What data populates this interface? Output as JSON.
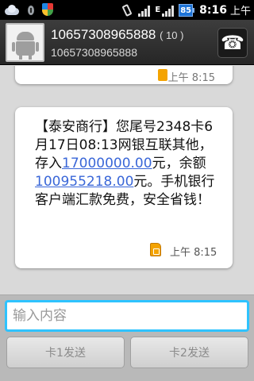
{
  "status_bar": {
    "time": "8:16",
    "ampm": "上午",
    "network": "E",
    "battery": "85",
    "icons": [
      "weather-icon",
      "mic-icon",
      "shield-icon",
      "vibrate-icon",
      "signal-icon",
      "signal-icon",
      "battery-icon"
    ]
  },
  "header": {
    "contact_number": "10657308965888",
    "count": "( 10 )",
    "subtitle": "10657308965888",
    "call_icon": "phone-icon"
  },
  "conversation": {
    "previous_message_time": "上午 8:15",
    "message": {
      "text_before_link1": "【泰安商行】您尾号2348卡6月17日08:13网银互联其他，存入",
      "link1": "17000000.00",
      "text_between": "元，余额",
      "link2": "100955218.00",
      "text_after": "元。手机银行客户端汇款免费，安全省钱！",
      "time": "上午 8:15",
      "sim_icon": "sim-card-icon"
    }
  },
  "compose": {
    "placeholder": "输入内容",
    "send1_label": "卡1发送",
    "send2_label": "卡2发送"
  }
}
